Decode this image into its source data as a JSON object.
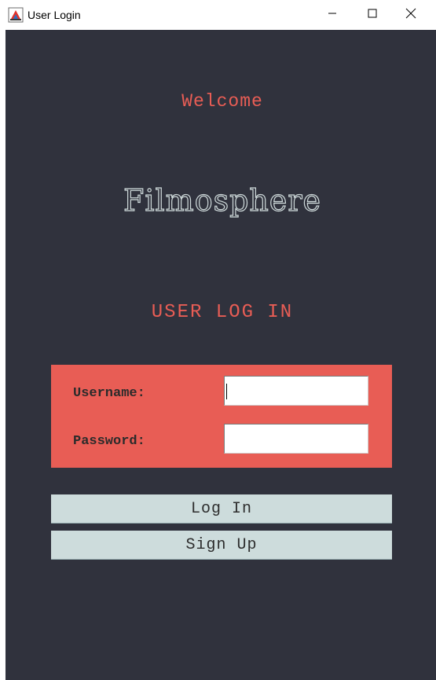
{
  "window": {
    "title": "User Login",
    "icons": {
      "app": "java-app-icon",
      "minimize": "minimize-icon",
      "maximize": "maximize-icon",
      "close": "close-icon"
    }
  },
  "header": {
    "welcome": "Welcome",
    "brand": "Filmosphere",
    "heading": "USER LOG IN"
  },
  "form": {
    "username_label": "Username:",
    "username_value": "",
    "password_label": "Password:",
    "password_value": ""
  },
  "actions": {
    "login_label": "Log In",
    "signup_label": "Sign Up"
  },
  "colors": {
    "background": "#30323d",
    "accent": "#e85d55",
    "button": "#cddcdc",
    "brand_outline": "#cfdadb"
  }
}
